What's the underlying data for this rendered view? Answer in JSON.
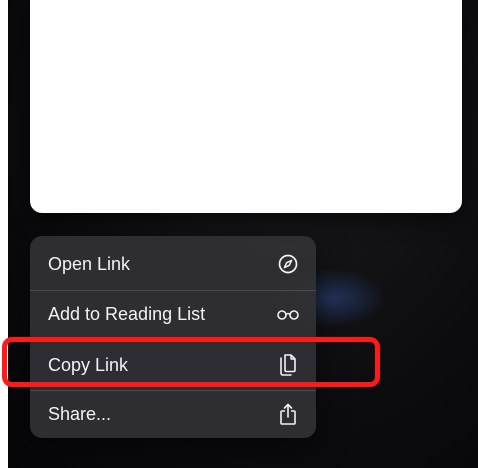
{
  "menu": {
    "items": [
      {
        "label": "Open Link",
        "icon": "compass-icon"
      },
      {
        "label": "Add to Reading List",
        "icon": "glasses-icon"
      },
      {
        "label": "Copy Link",
        "icon": "copy-document-icon"
      },
      {
        "label": "Share...",
        "icon": "share-icon"
      }
    ]
  },
  "annotation": {
    "highlighted_item": "Copy Link",
    "color": "#ff1a1a"
  },
  "colors": {
    "menu_background": "#303034",
    "menu_text": "#f2f2f4",
    "page_background": "#0c0c0f",
    "preview_card": "#ffffff"
  }
}
